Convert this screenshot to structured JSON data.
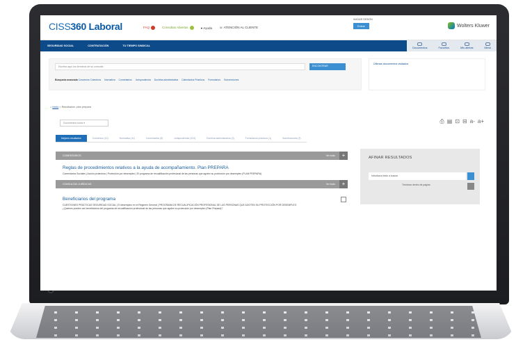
{
  "app": {
    "brand_prefix": "CISS",
    "brand_name": "360 Laboral",
    "top_links": [
      "FAQ",
      "Consultas Abiertas",
      "Ayuda",
      "ATENCIÓN AL CLIENTE"
    ],
    "login_label": "INICIAR SESIÓN",
    "login_button": "Entrar",
    "partner_logo": "Wolters Kluwer"
  },
  "nav": {
    "items": [
      "SEGURIDAD SOCIAL",
      "CONTRATACIÓN",
      "TU TIEMPO SINDICAL"
    ],
    "right_items": [
      "Documentos",
      "Favoritos",
      "Mis alertas",
      "Menú"
    ]
  },
  "search": {
    "placeholder": "Escriba aquí los términos de su consulta",
    "button": "ENCONTRAR",
    "popular_label": "Búsqueda avanzada",
    "popular_links": [
      "Convenios Colectivos",
      "Normativa",
      "Comentarios",
      "Jurisprudencia",
      "Doctrina administrativa",
      "Calendarios Prácticos",
      "Formularios",
      "Subvenciones"
    ],
    "last_searches_title": "Últimas documentos visitados"
  },
  "breadcrumb": {
    "home": "Inicio",
    "current": "Resultados: plan prepara"
  },
  "filter_select": "Documentos todos",
  "tabs": [
    "Mejores resultados",
    "Convenios (12)",
    "Normativa (11)",
    "Comentarios (5)",
    "Jurisprudencia (224)",
    "Doctrina administrativa (3)",
    "Formularios prácticos (1)",
    "Subvenciones (2)"
  ],
  "results": [
    {
      "section": "COMENTARIOS",
      "more": "Ver todo",
      "title": "Reglas de procedimientos relativos a la ayuda de acompañamiento. Plan PREPARA",
      "snippet": "Comentarios Sociales | Acción protectora | Protección por desempleo | El programa de recualificación profesional de las personas que agoten su protección por desempleo (PLAN PREPARA)"
    },
    {
      "section": "CONSULTAS JURÍDICAS",
      "more": "Ver todo",
      "title": "Beneficiarios del programa",
      "snippet": "CUESTIONES PRÁCTICAS SEGURIDAD SOCIAL | El desempleo en el Régimen General | PROGRAMA DE RECUALIFICACIÓN PROFESIONAL DE LAS PERSONAS QUE AGOTEN SU PROTECCIÓN POR DESEMPLEO",
      "snippet2": "¿Quiénes pueden ser beneficiarios del programa de recualificación profesional de las personas que agoten su protección por desempleo (Plan Prepara)?"
    }
  ],
  "refine": {
    "title": "AFINAR RESULTADOS",
    "input": "Introduzca texto a buscar",
    "option": "Términos dentro de página"
  }
}
